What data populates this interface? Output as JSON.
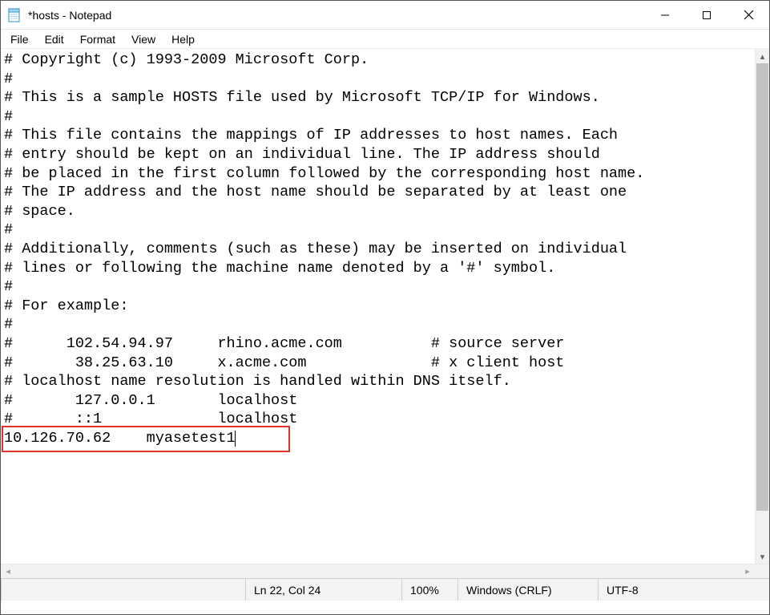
{
  "window": {
    "title": "*hosts - Notepad"
  },
  "menu": {
    "file": "File",
    "edit": "Edit",
    "format": "Format",
    "view": "View",
    "help": "Help"
  },
  "content": {
    "lines": [
      "# Copyright (c) 1993-2009 Microsoft Corp.",
      "#",
      "# This is a sample HOSTS file used by Microsoft TCP/IP for Windows.",
      "#",
      "# This file contains the mappings of IP addresses to host names. Each",
      "# entry should be kept on an individual line. The IP address should",
      "# be placed in the first column followed by the corresponding host name.",
      "# The IP address and the host name should be separated by at least one",
      "# space.",
      "#",
      "# Additionally, comments (such as these) may be inserted on individual",
      "# lines or following the machine name denoted by a '#' symbol.",
      "#",
      "# For example:",
      "#",
      "#      102.54.94.97     rhino.acme.com          # source server",
      "#       38.25.63.10     x.acme.com              # x client host",
      "",
      "# localhost name resolution is handled within DNS itself.",
      "#       127.0.0.1       localhost",
      "#       ::1             localhost",
      "10.126.70.62    myasetest1"
    ]
  },
  "highlight": {
    "ip": "10.126.70.62",
    "hostname": "myasetest1"
  },
  "status": {
    "position": "Ln 22, Col 24",
    "zoom": "100%",
    "line_ending": "Windows (CRLF)",
    "encoding": "UTF-8"
  }
}
